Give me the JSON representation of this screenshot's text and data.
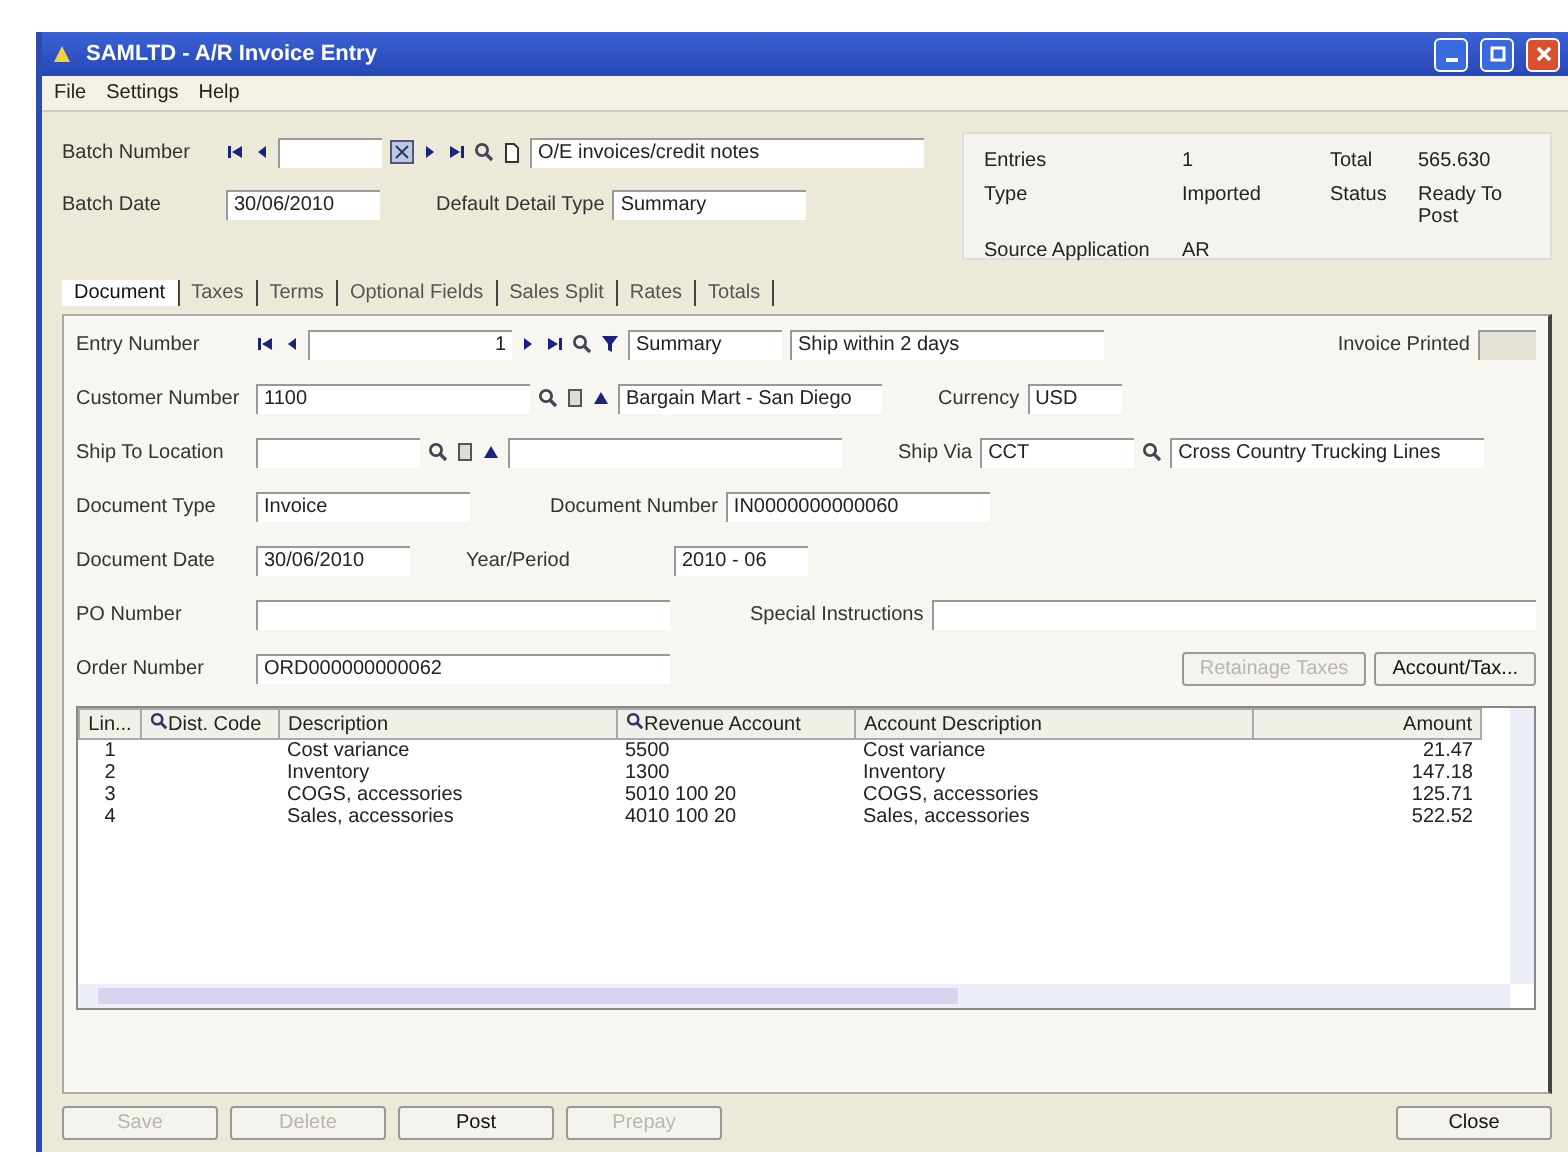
{
  "window": {
    "title": "SAMLTD - A/R Invoice Entry"
  },
  "menu": [
    "File",
    "Settings",
    "Help"
  ],
  "batch": {
    "number_label": "Batch Number",
    "description": "O/E invoices/credit notes",
    "date_label": "Batch Date",
    "date": "30/06/2010",
    "detail_label": "Default Detail Type",
    "detail": "Summary"
  },
  "info": {
    "entries_label": "Entries",
    "entries": "1",
    "total_label": "Total",
    "total": "565.630",
    "type_label": "Type",
    "type": "Imported",
    "status_label": "Status",
    "status": "Ready To Post",
    "source_label": "Source Application",
    "source": "AR"
  },
  "tabs": [
    {
      "label": "Document",
      "selected": true
    },
    {
      "label": "Taxes",
      "selected": false
    },
    {
      "label": "Terms",
      "selected": false
    },
    {
      "label": "Optional Fields",
      "selected": false
    },
    {
      "label": "Sales Split",
      "selected": false
    },
    {
      "label": "Rates",
      "selected": false
    },
    {
      "label": "Totals",
      "selected": false
    }
  ],
  "entry": {
    "label": "Entry Number",
    "value": "1",
    "detail": "Summary",
    "description": "Ship within 2 days",
    "printed_label": "Invoice Printed",
    "printed": false
  },
  "customer": {
    "label": "Customer Number",
    "value": "1100",
    "name": "Bargain Mart - San Diego",
    "currency_label": "Currency",
    "currency": "USD"
  },
  "ship_to": {
    "label": "Ship To Location",
    "ship_via_label": "Ship Via",
    "ship_via": "CCT",
    "ship_via_name": "Cross Country Trucking Lines"
  },
  "document": {
    "type_label": "Document Type",
    "type": "Invoice",
    "number_label": "Document Number",
    "number": "IN0000000000060",
    "date_label": "Document Date",
    "date": "30/06/2010",
    "period_label": "Year/Period",
    "period": "2010 - 06",
    "po_label": "PO Number",
    "special_label": "Special Instructions",
    "order_label": "Order Number",
    "order": "ORD000000000062"
  },
  "side_buttons": [
    {
      "label": "Retainage Taxes",
      "disabled": true
    },
    {
      "label": "Account/Tax...",
      "disabled": false
    }
  ],
  "table": {
    "columns": [
      "Lin...",
      "Dist. Code",
      "Description",
      "Revenue Account",
      "Account Description",
      "Amount"
    ],
    "rows": [
      [
        "1",
        "",
        "Cost variance",
        "5500",
        "Cost variance",
        "21.47"
      ],
      [
        "2",
        "",
        "Inventory",
        "1300",
        "Inventory",
        "147.18"
      ],
      [
        "3",
        "",
        "COGS, accessories",
        "5010 100 20",
        "COGS, accessories",
        "125.71"
      ],
      [
        "4",
        "",
        "Sales, accessories",
        "4010 100 20",
        "Sales, accessories",
        "522.52"
      ]
    ]
  },
  "buttons": [
    {
      "label": "Save",
      "disabled": true
    },
    {
      "label": "Delete",
      "disabled": true
    },
    {
      "label": "Post",
      "disabled": false
    },
    {
      "label": "Prepay",
      "disabled": true
    },
    {
      "label": "Close",
      "disabled": false
    }
  ]
}
